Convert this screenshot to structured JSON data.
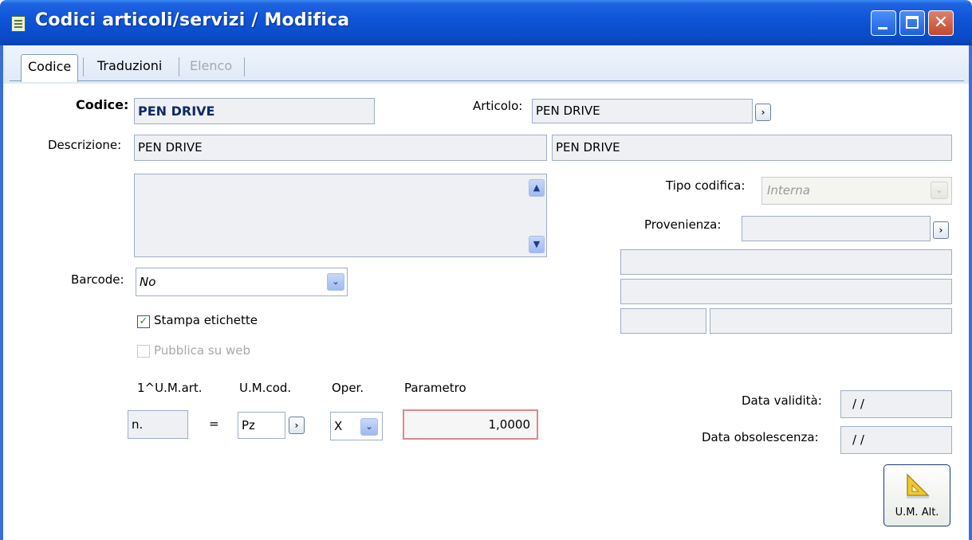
{
  "window": {
    "title": "Codici articoli/servizi / Modifica",
    "minimize_glyph": "_",
    "maximize_glyph": "□",
    "close_glyph": "✕"
  },
  "tabs": [
    {
      "label": "Codice",
      "active": true,
      "enabled": true
    },
    {
      "label": "Traduzioni",
      "active": false,
      "enabled": true
    },
    {
      "label": "Elenco",
      "active": false,
      "enabled": false
    }
  ],
  "form": {
    "codice_label": "Codice:",
    "codice_value": "PEN DRIVE",
    "articolo_label": "Articolo:",
    "articolo_value": "PEN DRIVE",
    "descrizione_label": "Descrizione:",
    "descrizione_value": "PEN DRIVE",
    "descrizione_articolo": "PEN DRIVE",
    "tipo_codifica_label": "Tipo codifica:",
    "tipo_codifica_value": "Interna",
    "provenienza_label": "Provenienza:",
    "provenienza_value": "",
    "barcode_label": "Barcode:",
    "barcode_value": "No",
    "stampa_etichette_label": "Stampa etichette",
    "stampa_etichette_checked": true,
    "pubblica_web_label": "Pubblica su web",
    "pubblica_web_checked": false,
    "um_art_header": "1^U.M.art.",
    "um_cod_header": "U.M.cod.",
    "oper_header": "Oper.",
    "parametro_header": "Parametro",
    "um_art_value": "n.",
    "equals": "=",
    "um_cod_value": "Pz",
    "oper_value": "X",
    "parametro_value": "1,0000",
    "data_validita_label": "Data validità:",
    "data_validita_value": " /  /",
    "data_obsolescenza_label": "Data obsolescenza:",
    "data_obsolescenza_value": " /  /",
    "um_alt_button": "U.M. Alt."
  },
  "glyphs": {
    "zoom": "›",
    "combo": "⌄",
    "scroll_up": "▲",
    "scroll_down": "▼",
    "check": "✓"
  },
  "colors": {
    "titlebar": "#0a4cc9",
    "field_bg": "#eef0f3",
    "field_border": "#9eaec8",
    "parametro_border": "#d98a8a",
    "bold_value": "#0c2a66"
  }
}
